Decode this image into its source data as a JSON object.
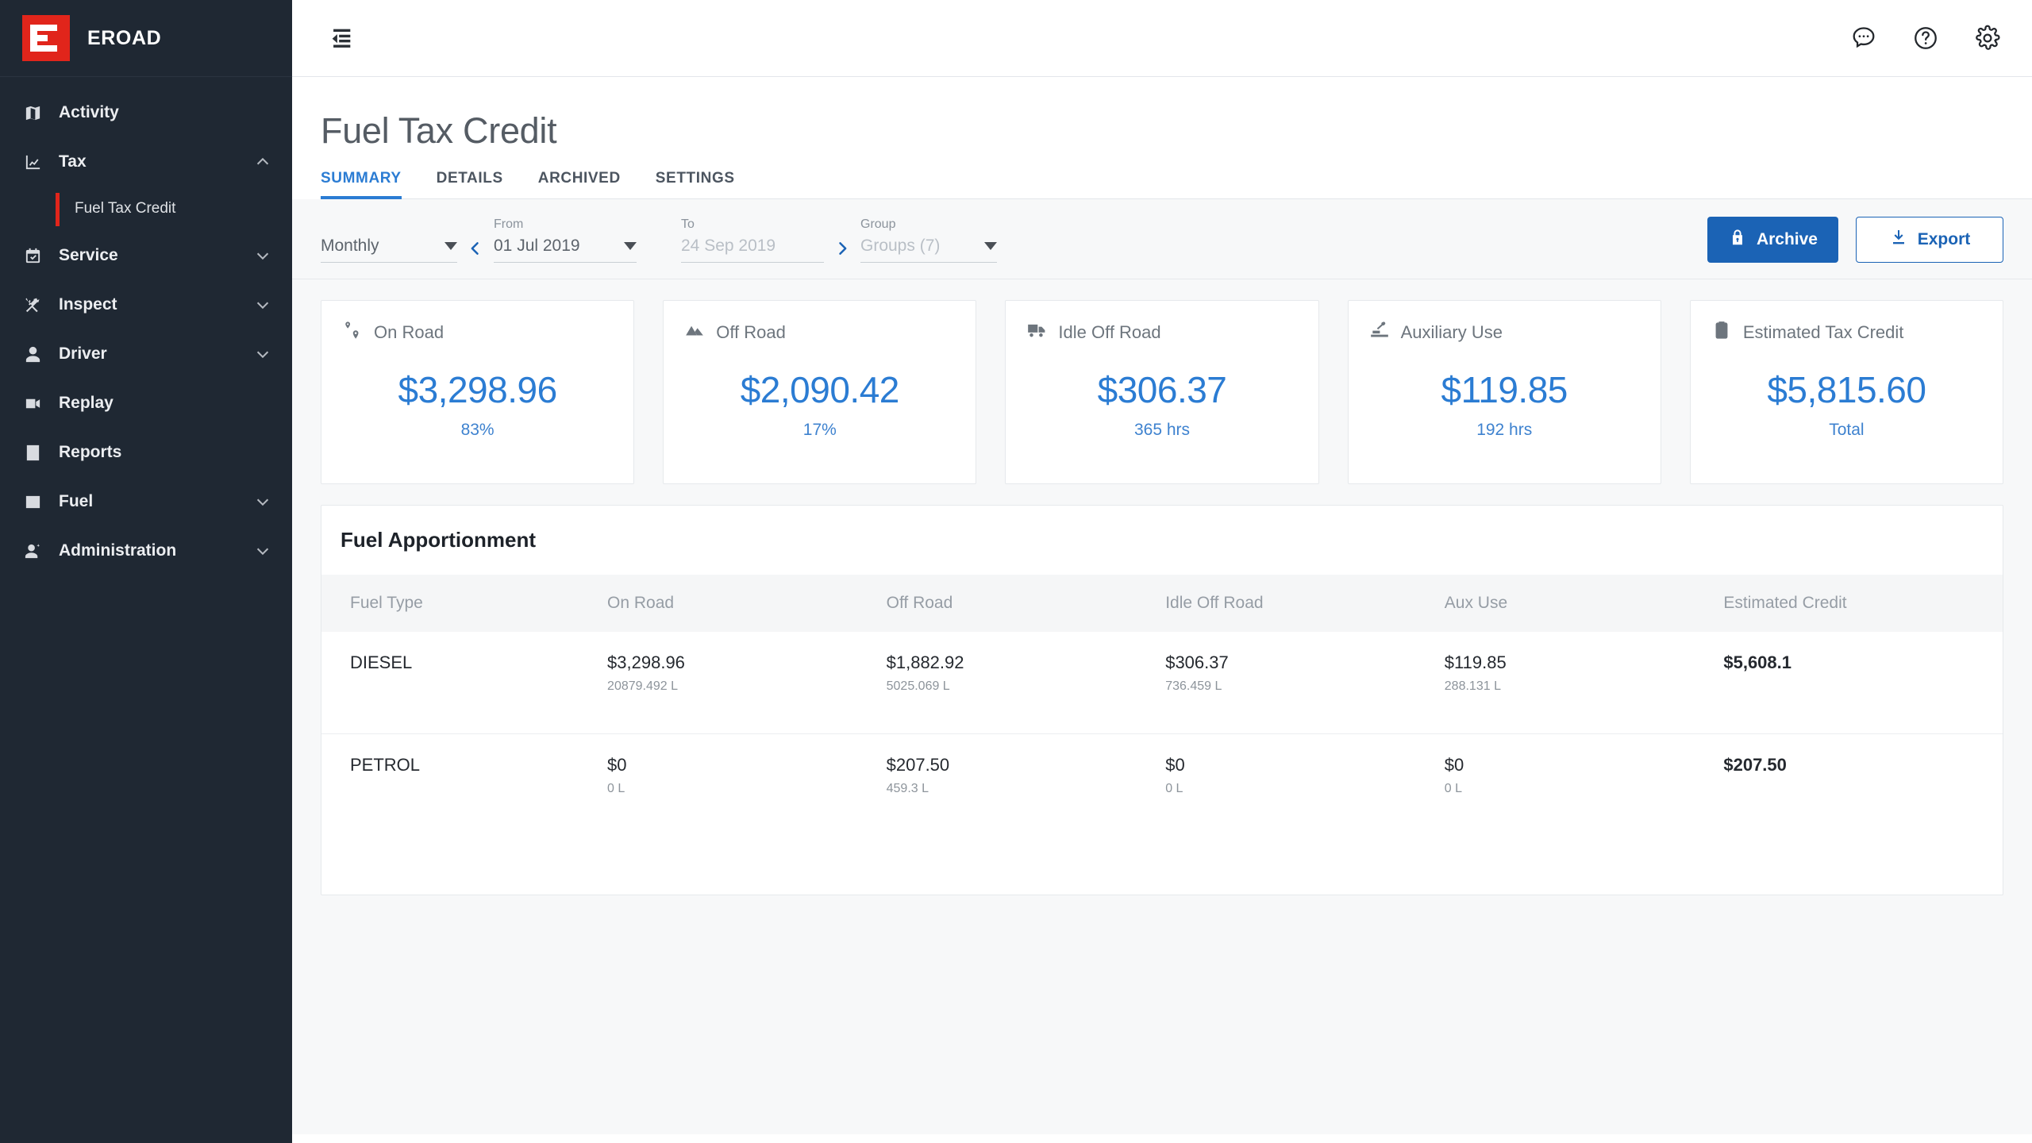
{
  "brand": {
    "name": "EROAD",
    "logo_icon": "eroad-logo"
  },
  "sidebar": {
    "items": [
      {
        "label": "Activity",
        "icon": "map-icon",
        "expandable": false
      },
      {
        "label": "Tax",
        "icon": "chart-line-icon",
        "expandable": true,
        "expanded": true
      },
      {
        "label": "Service",
        "icon": "calendar-check-icon",
        "expandable": true
      },
      {
        "label": "Inspect",
        "icon": "tools-icon",
        "expandable": true
      },
      {
        "label": "Driver",
        "icon": "person-icon",
        "expandable": true
      },
      {
        "label": "Replay",
        "icon": "video-camera-icon",
        "expandable": false
      },
      {
        "label": "Reports",
        "icon": "report-document-icon",
        "expandable": false
      },
      {
        "label": "Fuel",
        "icon": "fuel-card-icon",
        "expandable": true
      },
      {
        "label": "Administration",
        "icon": "person-gear-icon",
        "expandable": true
      }
    ],
    "sub_item": {
      "label": "Fuel Tax Credit",
      "active": true
    },
    "active_marker_color": "#e1251b"
  },
  "topbar": {
    "collapse_icon": "collapse-sidebar-icon",
    "icons": [
      {
        "name": "chat-bubble-icon"
      },
      {
        "name": "help-circle-icon"
      },
      {
        "name": "gear-icon"
      }
    ]
  },
  "page": {
    "title": "Fuel Tax Credit",
    "tabs": [
      {
        "label": "SUMMARY",
        "active": true
      },
      {
        "label": "DETAILS",
        "active": false
      },
      {
        "label": "ARCHIVED",
        "active": false
      },
      {
        "label": "SETTINGS",
        "active": false
      }
    ]
  },
  "filters": {
    "period": {
      "label": "",
      "value": "Monthly",
      "placeholder": "Monthly"
    },
    "prev_icon": "chevron-left-icon",
    "next_icon": "chevron-right-icon",
    "from": {
      "label": "From",
      "value": "01 Jul 2019"
    },
    "to": {
      "label": "To",
      "value": "24 Sep 2019",
      "muted": true
    },
    "group": {
      "label": "Group",
      "value": "Groups (7)"
    },
    "archive_button": {
      "label": "Archive",
      "icon": "lock-icon"
    },
    "export_button": {
      "label": "Export",
      "icon": "download-icon"
    }
  },
  "cards": [
    {
      "title": "On Road",
      "icon": "route-pin-icon",
      "value": "$3,298.96",
      "sub": "83%"
    },
    {
      "title": "Off Road",
      "icon": "mountain-icon",
      "value": "$2,090.42",
      "sub": "17%"
    },
    {
      "title": "Idle Off Road",
      "icon": "truck-icon",
      "value": "$306.37",
      "sub": "365 hrs"
    },
    {
      "title": "Auxiliary Use",
      "icon": "excavator-icon",
      "value": "$119.85",
      "sub": "192 hrs"
    },
    {
      "title": "Estimated Tax Credit",
      "icon": "clipboard-icon",
      "value": "$5,815.60",
      "sub": "Total"
    }
  ],
  "apportionment": {
    "title": "Fuel Apportionment",
    "columns": [
      "Fuel Type",
      "On Road",
      "Off Road",
      "Idle Off Road",
      "Aux Use",
      "Estimated Credit"
    ],
    "rows": [
      {
        "fuel_type": "DIESEL",
        "on_road": {
          "amount": "$3,298.96",
          "volume": "20879.492 L"
        },
        "off_road": {
          "amount": "$1,882.92",
          "volume": "5025.069 L"
        },
        "idle_off_road": {
          "amount": "$306.37",
          "volume": "736.459 L"
        },
        "aux_use": {
          "amount": "$119.85",
          "volume": "288.131 L"
        },
        "estimated_credit": "$5,608.1"
      },
      {
        "fuel_type": "PETROL",
        "on_road": {
          "amount": "$0",
          "volume": "0 L"
        },
        "off_road": {
          "amount": "$207.50",
          "volume": "459.3 L"
        },
        "idle_off_road": {
          "amount": "$0",
          "volume": "0 L"
        },
        "aux_use": {
          "amount": "$0",
          "volume": "0 L"
        },
        "estimated_credit": "$207.50"
      }
    ]
  },
  "colors": {
    "sidebar_bg": "#1f2833",
    "brand_red": "#e1251b",
    "accent_blue": "#2b7cd3",
    "primary_blue": "#1b63b5",
    "page_bg": "#f7f8f9"
  }
}
